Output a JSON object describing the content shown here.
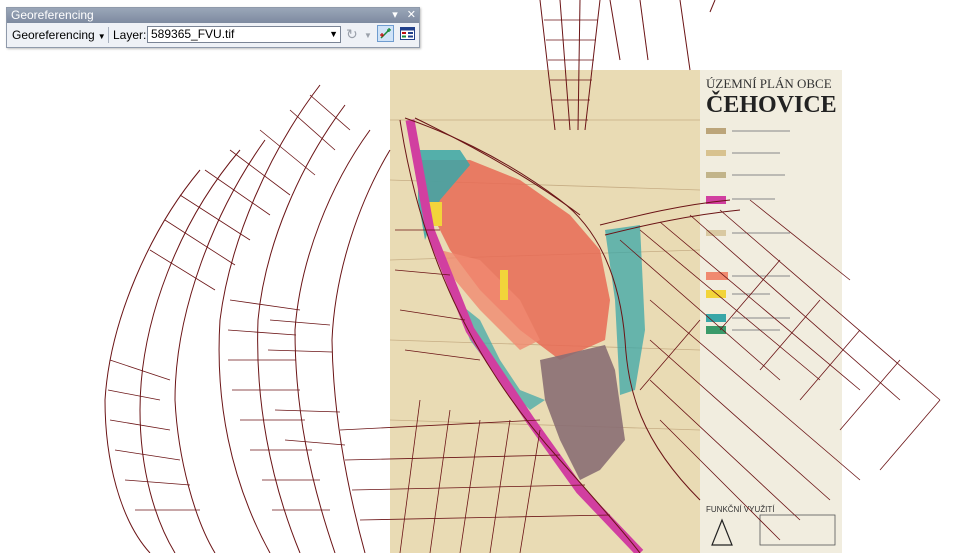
{
  "toolbar": {
    "title": "Georeferencing",
    "menu_label": "Georeferencing",
    "layer_label": "Layer:",
    "layer_value": "589365_FVU.tif",
    "icons": [
      "rotate-icon",
      "add-control-points-icon",
      "link-table-icon",
      "minimize-icon",
      "close-icon"
    ]
  },
  "map": {
    "plan_title_line1": "ÚZEMNÍ PLÁN OBCE",
    "plan_title_line2": "ČEHOVICE",
    "plan_footer": "FUNKČNÍ VYUŽITÍ",
    "colors": {
      "parcel_line": "#6b1416",
      "raster_bg": "#e8d9b0",
      "residential": "#e86a55",
      "road": "#d13fa0",
      "water": "#39a7a8",
      "industrial": "#8a6e73"
    }
  }
}
